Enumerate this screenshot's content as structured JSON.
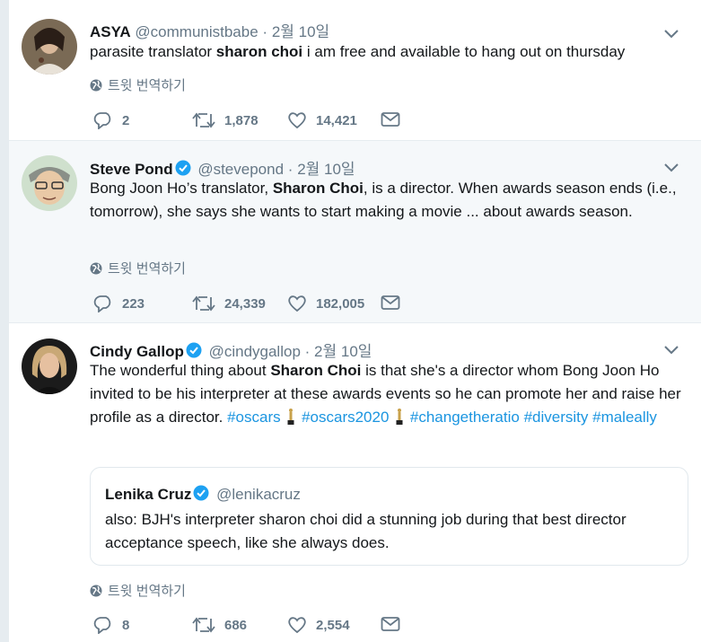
{
  "colors": {
    "link": "#1b95e0",
    "verified": "#1da1f2",
    "muted": "#657786"
  },
  "translate_label": "트윗 번역하기",
  "tweets": [
    {
      "name": "ASYA",
      "handle": "@communistbabe",
      "sep": "·",
      "date": "2월 10일",
      "text_pre": "parasite translator ",
      "text_bold": "sharon choi",
      "text_post": " i am free and available to hang out on thursday",
      "replies": "2",
      "retweets": "1,878",
      "likes": "14,421"
    },
    {
      "name": "Steve Pond",
      "handle": "@stevepond",
      "sep": "·",
      "date": "2월 10일",
      "text_pre": "Bong Joon Ho’s translator, ",
      "text_bold": "Sharon Choi",
      "text_post": ", is a director. When awards season ends (i.e., tomorrow), she says she wants to start making a movie ... about awards season.",
      "replies": "223",
      "retweets": "24,339",
      "likes": "182,005"
    },
    {
      "name": "Cindy Gallop",
      "handle": "@cindygallop",
      "sep": "·",
      "date": "2월 10일",
      "text_pre": "The wonderful thing about ",
      "text_bold": "Sharon Choi",
      "text_post": " is that she's a director whom Bong Joon Ho invited to be his interpreter at these awards events so he can promote her and raise her profile as a director. ",
      "hashtags": [
        "#oscars",
        "#oscars2020",
        "#changetheratio",
        "#diversity",
        "#maleally"
      ],
      "quote": {
        "name": "Lenika Cruz",
        "handle": "@lenikacruz",
        "text": "also: BJH's interpreter sharon choi did a stunning job during that best director acceptance speech, like she always does."
      },
      "replies": "8",
      "retweets": "686",
      "likes": "2,554"
    }
  ]
}
